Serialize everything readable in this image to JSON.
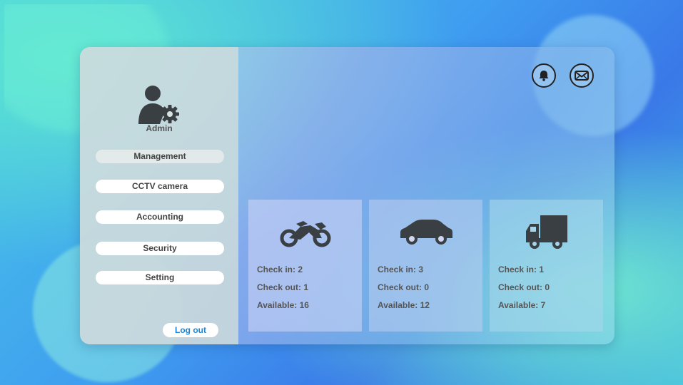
{
  "user": {
    "role_label": "Admin"
  },
  "sidebar": {
    "items": [
      {
        "label": "Management",
        "active": true
      },
      {
        "label": "CCTV camera",
        "active": false
      },
      {
        "label": "Accounting",
        "active": false
      },
      {
        "label": "Security",
        "active": false
      },
      {
        "label": "Setting",
        "active": false
      }
    ],
    "logout_label": "Log out"
  },
  "header": {
    "icons": [
      "bell-icon",
      "mail-icon"
    ]
  },
  "vehicles": [
    {
      "type": "motorcycle",
      "icon": "motorcycle-icon",
      "check_in_label": "Check in:",
      "check_in": "2",
      "check_out_label": "Check out:",
      "check_out": "1",
      "available_label": "Available:",
      "available": "16"
    },
    {
      "type": "car",
      "icon": "car-icon",
      "check_in_label": "Check in:",
      "check_in": "3",
      "check_out_label": "Check out:",
      "check_out": "0",
      "available_label": "Available:",
      "available": "12"
    },
    {
      "type": "truck",
      "icon": "truck-icon",
      "check_in_label": "Check in:",
      "check_in": "1",
      "check_out_label": "Check out:",
      "check_out": "0",
      "available_label": "Available:",
      "available": "7"
    }
  ],
  "colors": {
    "accent": "#1a86d6",
    "icon": "#3a3f44"
  }
}
